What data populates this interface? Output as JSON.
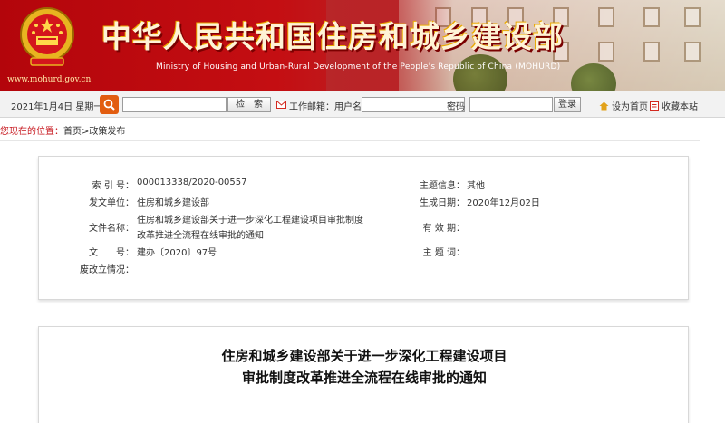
{
  "header": {
    "title_cn": "中华人民共和国住房和城乡建设部",
    "title_en": "Ministry of Housing and Urban-Rural Development of the People's Republic of China (MOHURD)",
    "site_url": "www.mohurd.gov.cn",
    "emblem_icon": "national-emblem-icon",
    "colors": {
      "banner_red": "#c40e12",
      "title_gold": "#fff3d6"
    }
  },
  "toolbar": {
    "date": "2021年1月4日 星期一",
    "search_placeholder": "",
    "search_label": "检　索",
    "mail_label": "工作邮箱：用户名",
    "username_value": "",
    "password_label": "密码",
    "password_value": "",
    "login_label": "登录",
    "home_label": "设为首页",
    "favorite_label": "收藏本站"
  },
  "breadcrumb": {
    "label": "您现在的位置：",
    "path": "首页>政策发布"
  },
  "info": {
    "index_no": {
      "label": "索 引 号：",
      "value": "000013338/2020-00557"
    },
    "topic_info": {
      "label": "主题信息：",
      "value": "其他"
    },
    "issuer": {
      "label": "发文单位：",
      "value": "住房和城乡建设部"
    },
    "issue_date": {
      "label": "生成日期：",
      "value": "2020年12月02日"
    },
    "doc_name": {
      "label": "文件名称：",
      "value_line1": "住房和城乡建设部关于进一步深化工程建设项目审批制度",
      "value_line2": "改革推进全流程在线审批的通知"
    },
    "validity": {
      "label": "有 效 期：",
      "value": ""
    },
    "doc_no": {
      "label": "文　　号：",
      "value": "建办〔2020〕97号"
    },
    "subject_words": {
      "label": "主 题 词：",
      "value": ""
    },
    "status": {
      "label": "废改立情况：",
      "value": ""
    }
  },
  "article": {
    "title_line1": "住房和城乡建设部关于进一步深化工程建设项目",
    "title_line2": "审批制度改革推进全流程在线审批的通知"
  }
}
